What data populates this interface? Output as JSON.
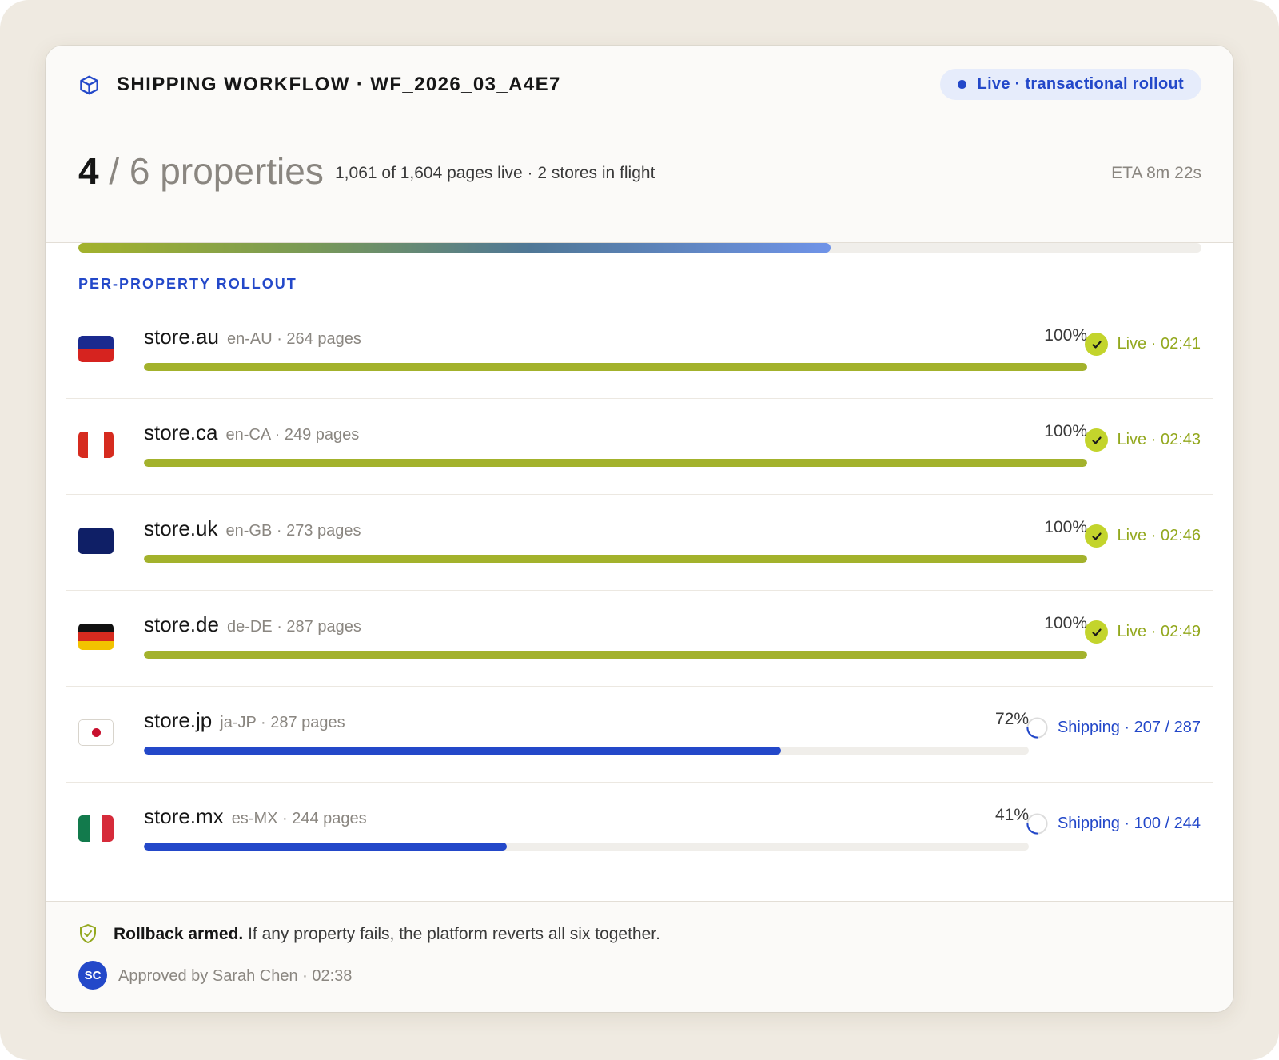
{
  "header": {
    "title": "SHIPPING WORKFLOW · WF_2026_03_A4E7",
    "status_pill": "Live · transactional rollout",
    "accent_color": "#2348c9"
  },
  "summary": {
    "done": "4",
    "total_label": " / 6 properties",
    "detail": "1,061 of 1,604 pages live · 2 stores in flight",
    "eta": "ETA 8m 22s",
    "progress": 0.67
  },
  "section": {
    "label": "PER-PROPERTY ROLLOUT"
  },
  "stores": [
    {
      "name": "store.au",
      "meta": "en-AU · 264 pages",
      "pct_label": "100%",
      "progress": 1.0,
      "state": "live",
      "status": "Live · 02:41",
      "flag": "au"
    },
    {
      "name": "store.ca",
      "meta": "en-CA · 249 pages",
      "pct_label": "100%",
      "progress": 1.0,
      "state": "live",
      "status": "Live · 02:43",
      "flag": "ca"
    },
    {
      "name": "store.uk",
      "meta": "en-GB · 273 pages",
      "pct_label": "100%",
      "progress": 1.0,
      "state": "live",
      "status": "Live · 02:46",
      "flag": "uk"
    },
    {
      "name": "store.de",
      "meta": "de-DE · 287 pages",
      "pct_label": "100%",
      "progress": 1.0,
      "state": "live",
      "status": "Live · 02:49",
      "flag": "de"
    },
    {
      "name": "store.jp",
      "meta": "ja-JP · 287 pages",
      "pct_label": "72%",
      "progress": 0.72,
      "state": "shipping",
      "status": "Shipping · 207 / 287",
      "flag": "jp"
    },
    {
      "name": "store.mx",
      "meta": "es-MX · 244 pages",
      "pct_label": "41%",
      "progress": 0.41,
      "state": "shipping",
      "status": "Shipping · 100 / 244",
      "flag": "mx"
    }
  ],
  "footer": {
    "rollback_title": "Rollback armed.",
    "rollback_text": " If any property fails, the platform reverts all six together.",
    "avatar_initials": "SC",
    "approved": "Approved by Sarah Chen · 02:38"
  },
  "colors": {
    "live_green": "#a3b22c",
    "live_text": "#93a81e",
    "shipping_blue": "#2348c9"
  },
  "icons": {
    "header": "cube-icon",
    "live": "check-circle-icon",
    "shipping": "spinner-icon",
    "footer": "shield-check-icon"
  }
}
